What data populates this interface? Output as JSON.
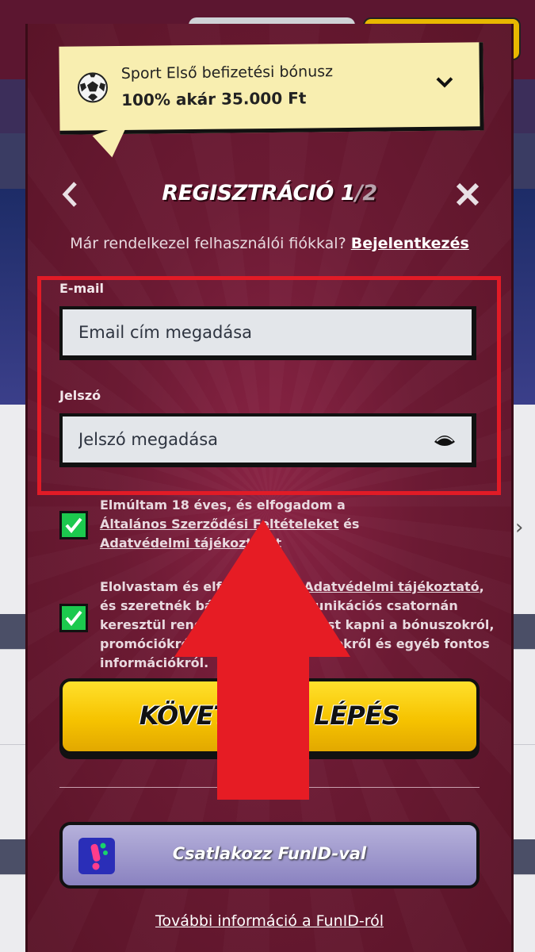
{
  "bonus": {
    "title": "Sport Első befizetési bónusz",
    "amount": "100% akár 35.000 Ft"
  },
  "header": {
    "title_main": "REGISZTRÁCIÓ 1",
    "title_slash": "/",
    "title_total": "2"
  },
  "login_prompt": {
    "text": "Már rendelkezel felhasználói fiókkal?",
    "link": "Bejelentkezés"
  },
  "form": {
    "email_label": "E-mail",
    "email_placeholder": "Email cím megadása",
    "password_label": "Jelszó",
    "password_placeholder": "Jelszó megadása"
  },
  "consents": [
    {
      "checked": true,
      "line1": "Elmúltam 18 éves, és elfogadom a",
      "link1": "Általános Szerződési Feltételeket",
      "mid": " és",
      "link2": "Adatvédelmi tájékoztatót"
    },
    {
      "checked": true,
      "text_start": "Elolvastam és elfogadom az ",
      "link": "Adatvédelmi tájékoztató",
      "text_end": ", és szeretnék bármilyen kommunikációs csatornán keresztül rendszeresen értesítést kapni a bónuszokról, promóciókról, a legfontosabb hírekről és egyéb fontos információkról."
    }
  ],
  "next_button": "KÖVETKEZŐ LÉPÉS",
  "funid_button": "Csatlakozz FunID-val",
  "funid_more": "További információ a FunID-ról",
  "colors": {
    "modal": "#6b1a33",
    "highlight_box": "#e11b26",
    "next_button": "#f6c300",
    "checkbox": "#1cc94e",
    "arrow": "#e61c24"
  }
}
